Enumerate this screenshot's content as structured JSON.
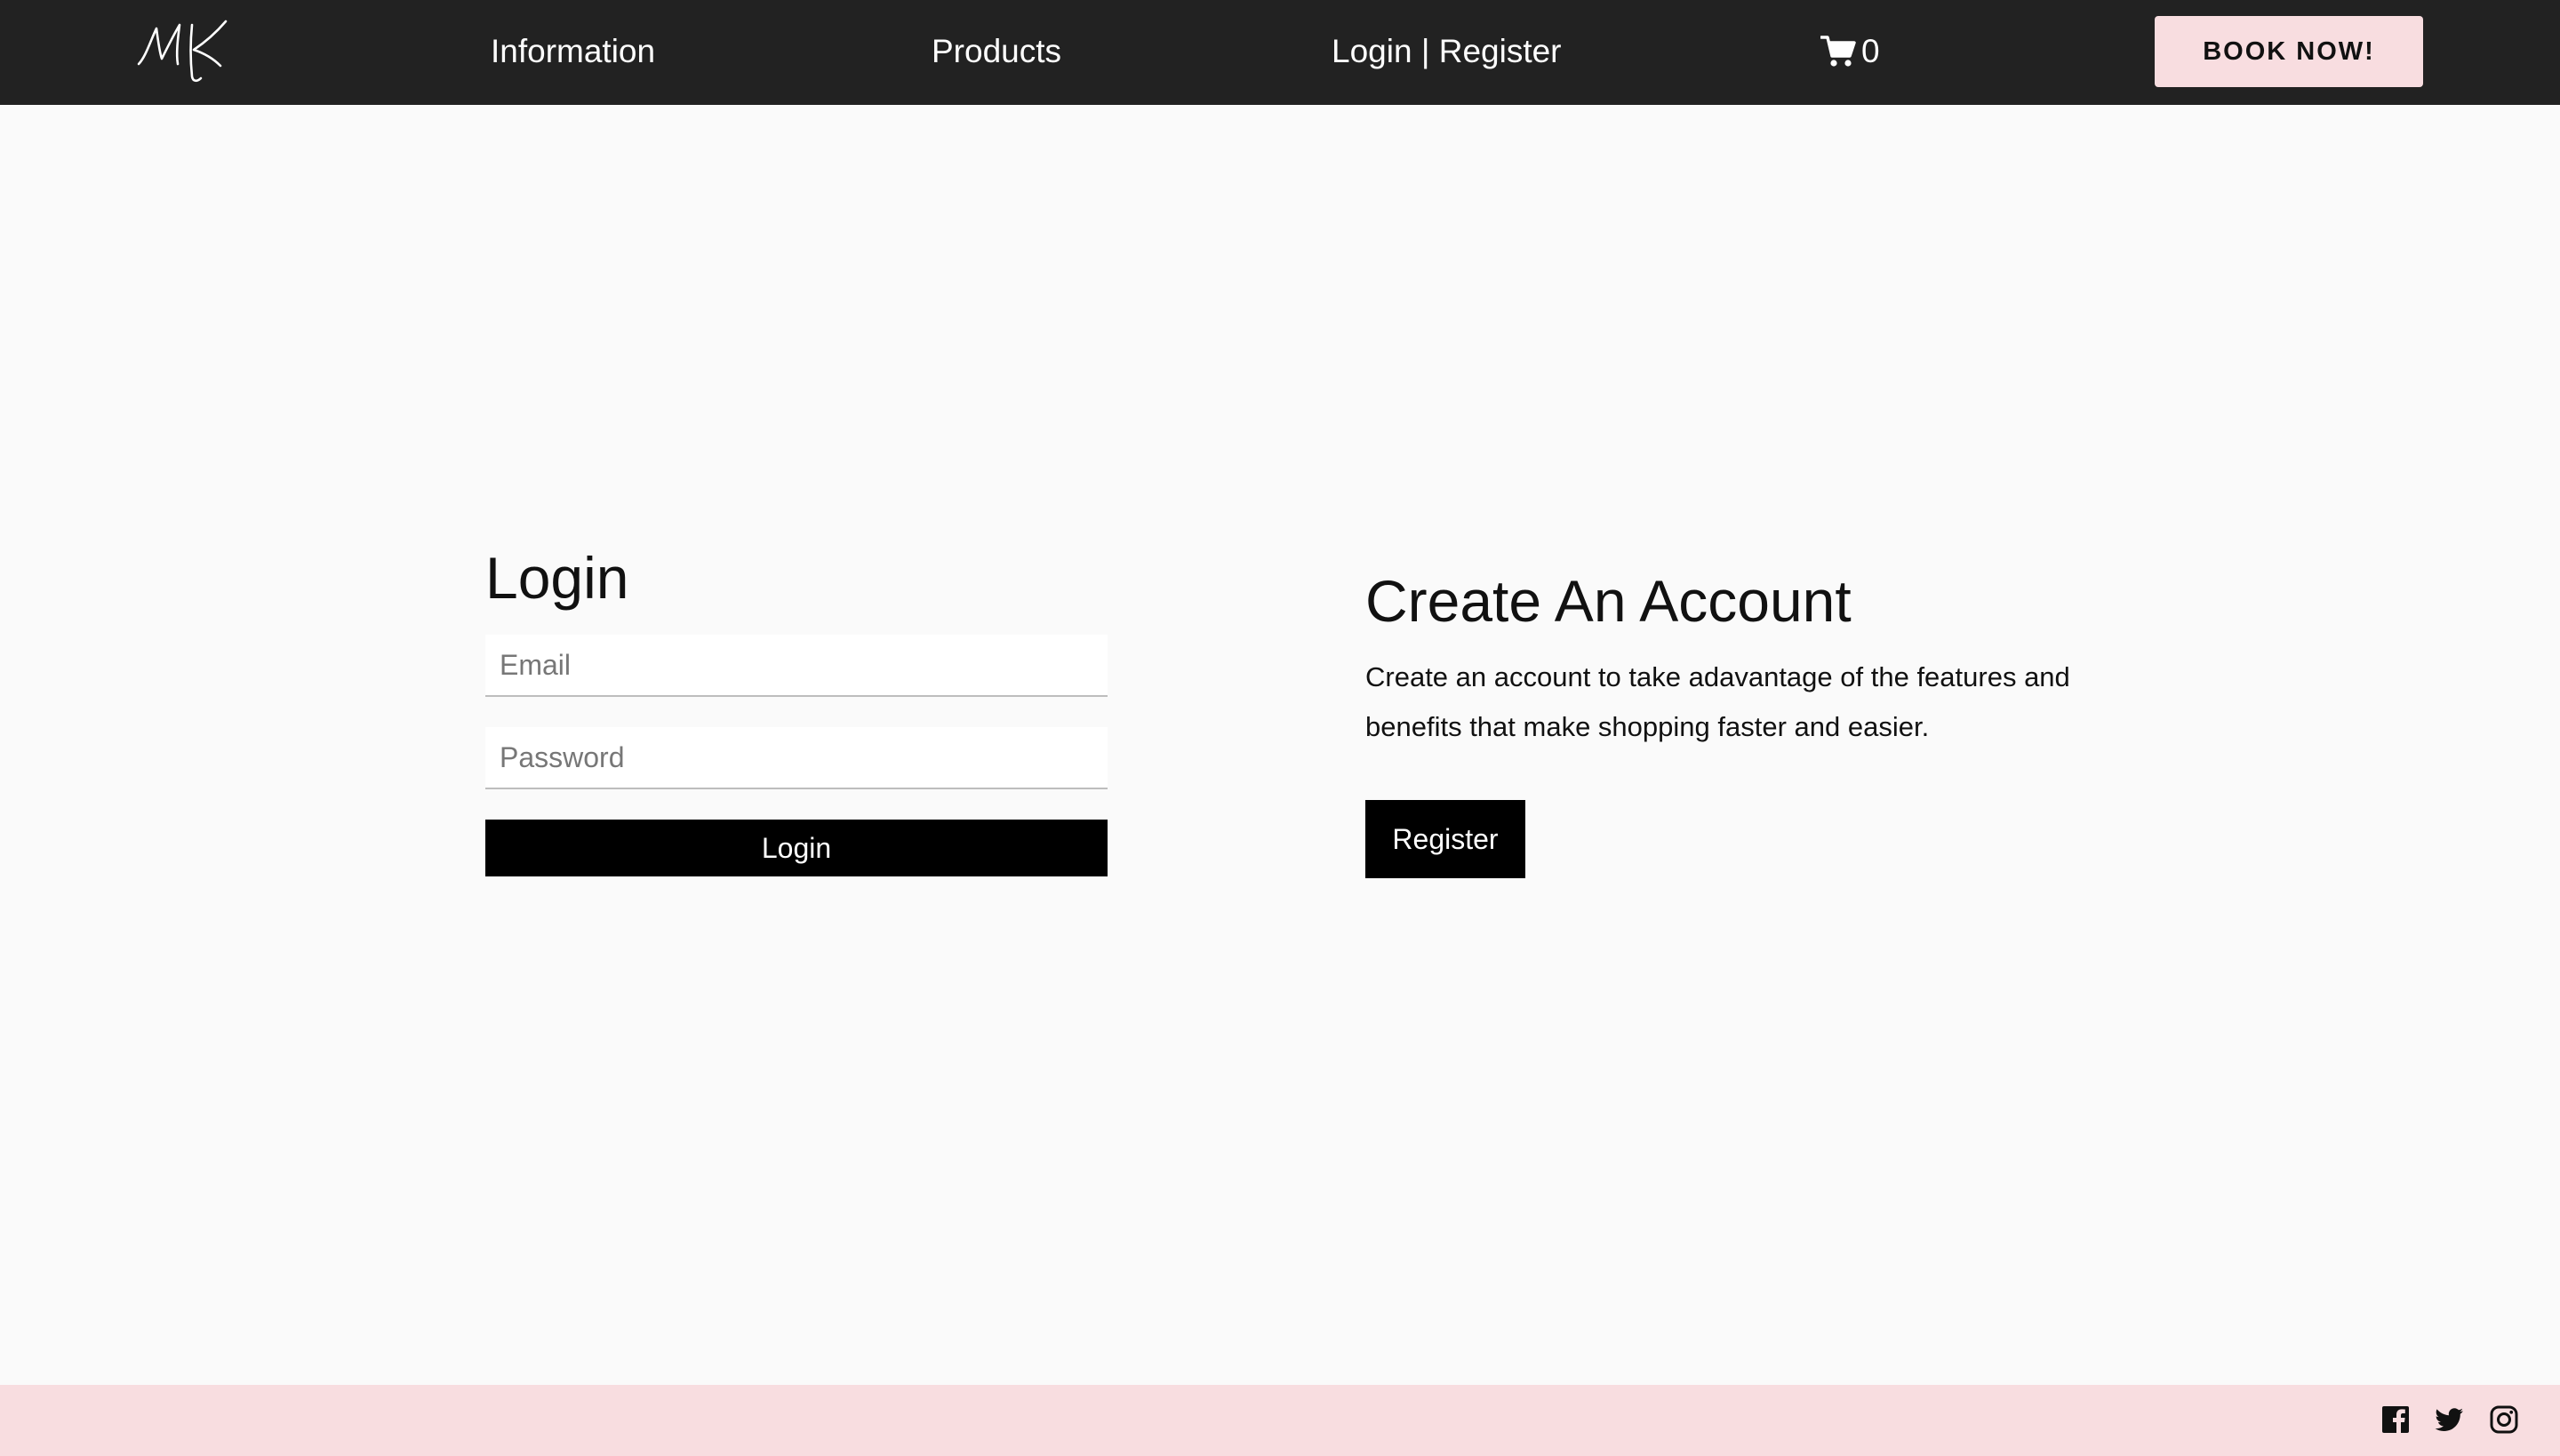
{
  "header": {
    "logo_text": "MK",
    "nav": {
      "information": "Information",
      "products": "Products",
      "login": "Login",
      "separator": "|",
      "register": "Register"
    },
    "cart": {
      "icon": "shopping-cart-icon",
      "count": "0"
    },
    "book_button": "BOOK NOW!"
  },
  "login": {
    "title": "Login",
    "email_placeholder": "Email",
    "email_value": "",
    "password_placeholder": "Password",
    "password_value": "",
    "button_label": "Login"
  },
  "create_account": {
    "title": "Create An Account",
    "description": "Create an account to take adavantage of the features and benefits that make shopping faster and easier.",
    "button_label": "Register"
  },
  "footer": {
    "social_icons": [
      "facebook-icon",
      "twitter-icon",
      "instagram-icon"
    ]
  },
  "colors": {
    "nav_background": "#222222",
    "page_background": "#fafafa",
    "accent_pink": "#f8dde0",
    "button_black": "#000000"
  }
}
